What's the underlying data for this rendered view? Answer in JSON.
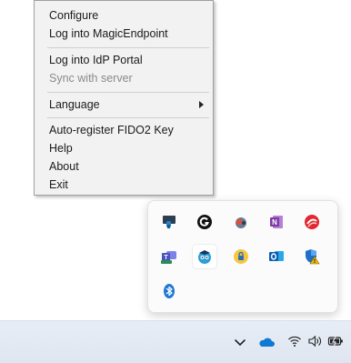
{
  "menu": {
    "items": [
      {
        "label": "Configure"
      },
      {
        "label": "Log into MagicEndpoint"
      },
      {
        "label": "Log into IdP Portal"
      },
      {
        "label": "Sync with server"
      },
      {
        "label": "Language"
      },
      {
        "label": "Auto-register FIDO2 Key"
      },
      {
        "label": "Help"
      },
      {
        "label": "About"
      },
      {
        "label": "Exit"
      }
    ]
  },
  "tray_overflow": {
    "icons": [
      "touchpad-hand-icon",
      "grammarly-icon",
      "recorder-icon",
      "onenote-icon",
      "red-swirl-icon",
      "teams-new-icon",
      "magicendpoint-owl-icon",
      "yellow-lock-icon",
      "outlook-icon",
      "defender-warning-icon",
      "bluetooth-icon"
    ]
  },
  "taskbar": {
    "icons": [
      "chevron-up-icon",
      "onedrive-cloud-icon",
      "wifi-icon",
      "speaker-icon",
      "battery-icon"
    ]
  },
  "colors": {
    "menu_bg": "#f2f2f2",
    "taskbar_bg": "#e3e9f3",
    "disabled_text": "#8a8a8a"
  }
}
